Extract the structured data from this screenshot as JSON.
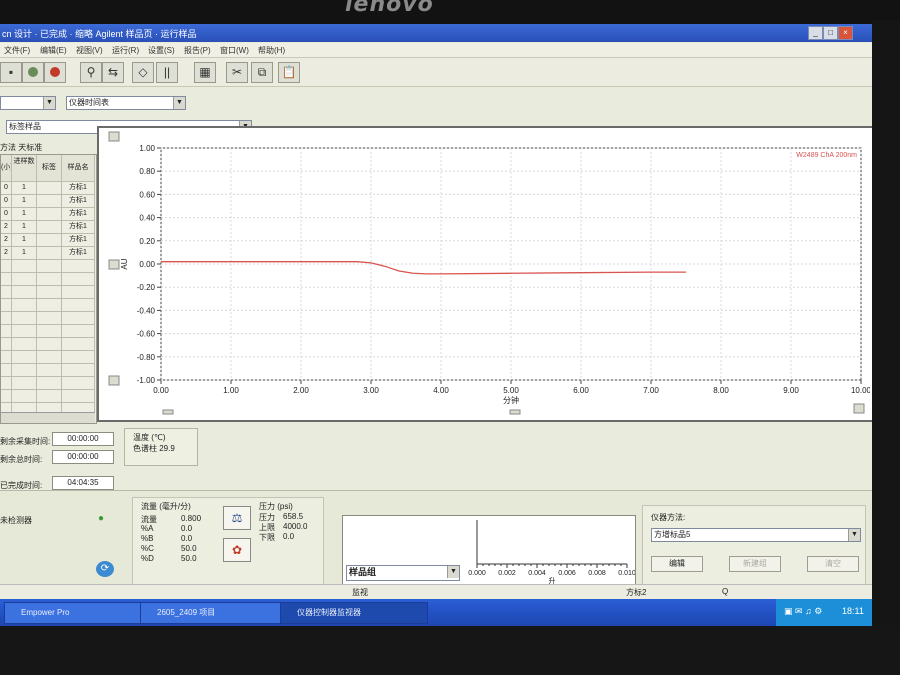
{
  "monitor": {
    "brand": "lenovo"
  },
  "window": {
    "title": "cn 设计 · 已完成 · 缩略 Agilent 样品页 · 运行样品",
    "minimize": "_",
    "maximize": "□",
    "close": "×"
  },
  "menu": [
    "文件(F)",
    "编辑(E)",
    "视图(V)",
    "运行(R)",
    "设置(S)",
    "报告(P)",
    "窗口(W)",
    "帮助(H)"
  ],
  "toolbar": {
    "icons": [
      "save-icon",
      "record-icon",
      "stop-icon",
      "inject-icon",
      "flow-icon",
      "column-icon",
      "gradient-icon",
      "table-icon",
      "cut-icon",
      "copy-icon",
      "paste-icon"
    ]
  },
  "selectors": {
    "left_combo": "",
    "mode_combo": "仪器时间表",
    "sample_combo": "标签样品"
  },
  "sample_table": {
    "method_label": "方法 天标准",
    "headers": [
      "(小)",
      "进样数",
      "标签",
      "样品名"
    ],
    "rows": [
      [
        "0",
        "1",
        "",
        "方标1"
      ],
      [
        "0",
        "1",
        "",
        "方标1"
      ],
      [
        "0",
        "1",
        "",
        "方标1"
      ],
      [
        "2",
        "1",
        "",
        "方标1"
      ],
      [
        "2",
        "1",
        "",
        "方标1"
      ],
      [
        "2",
        "1",
        "",
        "方标1"
      ]
    ]
  },
  "chart_data": {
    "type": "line",
    "title": "W2489 ChA 200nm",
    "xlabel": "分钟",
    "ylabel": "AU",
    "xlim": [
      0.0,
      10.0
    ],
    "ylim": [
      -1.0,
      1.0
    ],
    "x_ticks": [
      "0.00",
      "1.00",
      "2.00",
      "3.00",
      "4.00",
      "5.00",
      "6.00",
      "7.00",
      "8.00",
      "9.00",
      "10.00"
    ],
    "y_ticks": [
      "1.00",
      "0.80",
      "0.60",
      "0.40",
      "0.20",
      "0.00",
      "-0.20",
      "-0.40",
      "-0.60",
      "-0.80",
      "-1.00"
    ],
    "grid": true,
    "line_color": "#d9534f",
    "series": [
      {
        "name": "W2489 ChA 200nm",
        "x": [
          0.0,
          1.0,
          2.0,
          2.8,
          3.0,
          3.2,
          3.4,
          3.6,
          3.8,
          4.0,
          5.0,
          6.0,
          7.0,
          7.5
        ],
        "y": [
          0.02,
          0.02,
          0.02,
          0.02,
          0.01,
          -0.02,
          -0.06,
          -0.08,
          -0.085,
          -0.085,
          -0.08,
          -0.075,
          -0.07,
          -0.07
        ]
      }
    ]
  },
  "run_status": {
    "labels": [
      "剩余采集时间:",
      "剩余总时间:",
      "已完成时间:"
    ],
    "values": [
      "00:00:00",
      "00:00:00",
      "04:04:35"
    ],
    "temp_label": "温度 (℃)",
    "temp_value": "色谱柱 29.9"
  },
  "bottom": {
    "monitor_label": "未检测器",
    "flow": {
      "header": "流量 (毫升/分)",
      "rows": [
        [
          "流量",
          "0.800"
        ],
        [
          "%A",
          "0.0"
        ],
        [
          "%B",
          "0.0"
        ],
        [
          "%C",
          "50.0"
        ],
        [
          "%D",
          "50.0"
        ]
      ]
    },
    "pressure": {
      "header": "压力 (psi)",
      "rows": [
        [
          "压力",
          "658.5"
        ],
        [
          "上限",
          "4000.0"
        ],
        [
          "下限",
          "0.0"
        ]
      ]
    },
    "mini_chart": {
      "x_ticks": [
        "0.000",
        "0.002",
        "0.004",
        "0.006",
        "0.008",
        "0.010"
      ],
      "xlabel": "升"
    },
    "sample_group": "样品组",
    "instrument_method_label": "仪器方法:",
    "instrument_method": "方增标品5",
    "edit_button": "编辑",
    "btn2": "新建组",
    "btn3": "清空"
  },
  "statusbar": {
    "left": "监视",
    "mid": "方标2",
    "right": "Q"
  },
  "taskbar": {
    "items": [
      "Empower Pro",
      "2605_2409 项目",
      "仪器控制器监视器"
    ],
    "clock": "18:11"
  }
}
